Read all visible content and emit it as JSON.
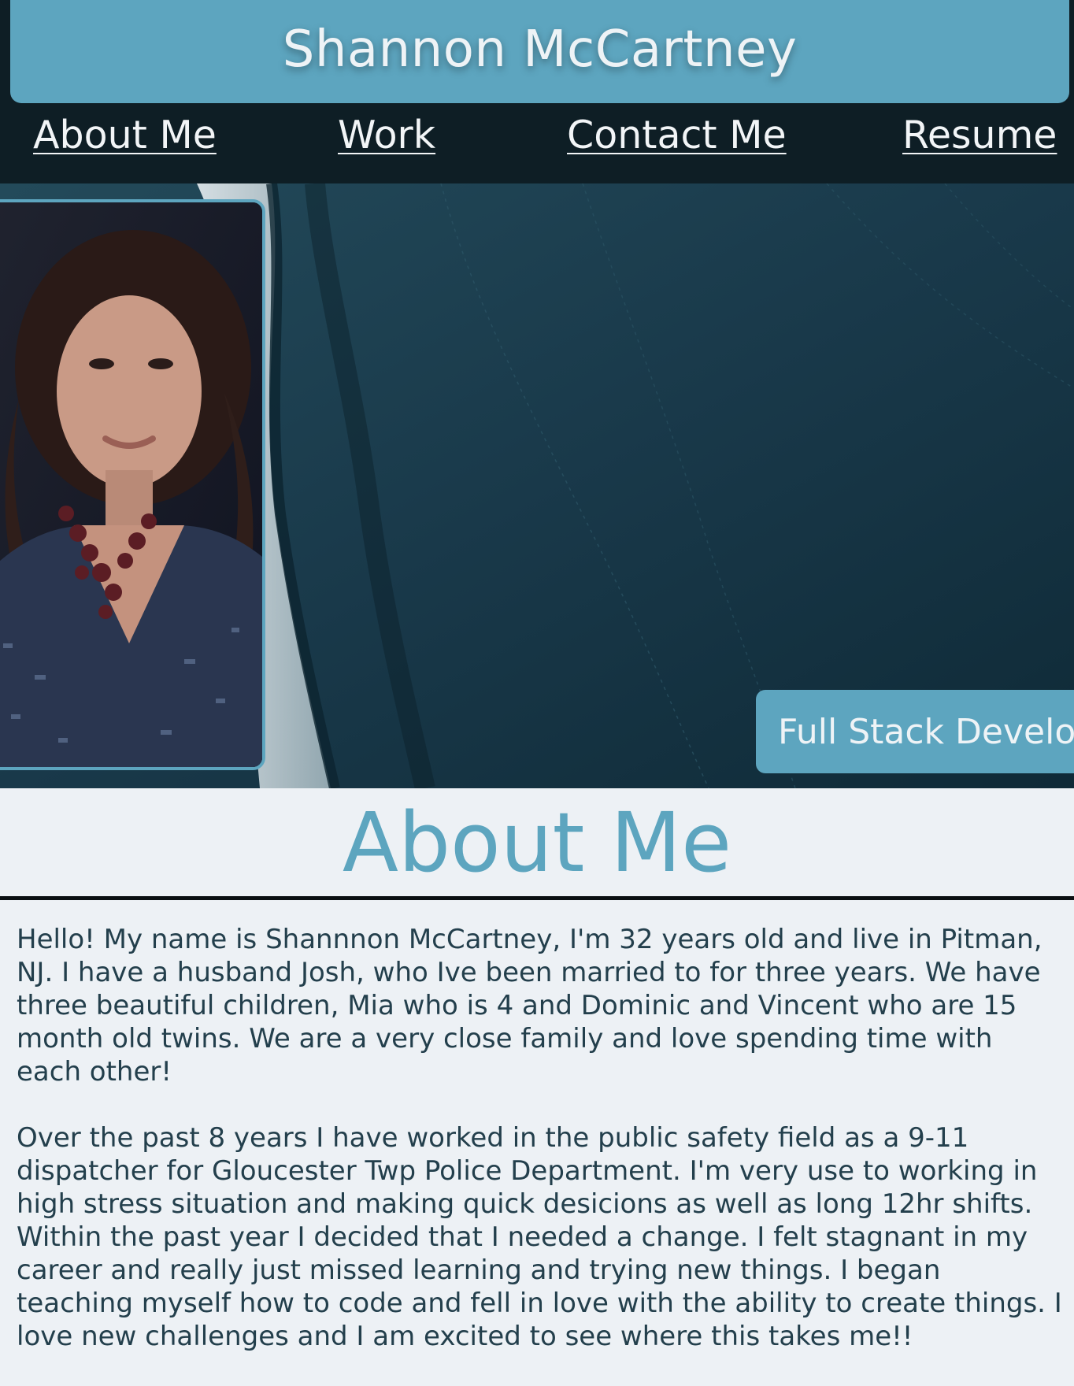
{
  "header": {
    "title": "Shannon McCartney"
  },
  "nav": {
    "items": [
      {
        "label": "About Me"
      },
      {
        "label": "Work"
      },
      {
        "label": "Contact Me"
      },
      {
        "label": "Resume"
      }
    ]
  },
  "hero": {
    "badge": "Full Stack Developer"
  },
  "about": {
    "heading": "About Me",
    "paragraphs": [
      "Hello! My name is Shannnon McCartney, I'm 32 years old and live in Pitman, NJ. I have a husband Josh, who Ive been married to for three years. We have three beautiful children, Mia who is 4 and Dominic and Vincent who are 15 month old twins. We are a very close family and love spending time with each other!",
      "Over the past 8 years I have worked in the public safety field as a 9-11 dispatcher for Gloucester Twp Police Department. I'm very use to working in high stress situation and making quick desicions as well as long 12hr shifts. Within the past year I decided that I needed a change. I felt stagnant in my career and really just missed learning and trying new things. I began teaching myself how to code and fell in love with the ability to create things. I love new challenges and I am excited to see where this takes me!!"
    ]
  },
  "colors": {
    "accent": "#5da5bf",
    "nav_bg": "#0e1e25",
    "page_bg": "#edf1f5",
    "body_text": "#233f4c"
  }
}
